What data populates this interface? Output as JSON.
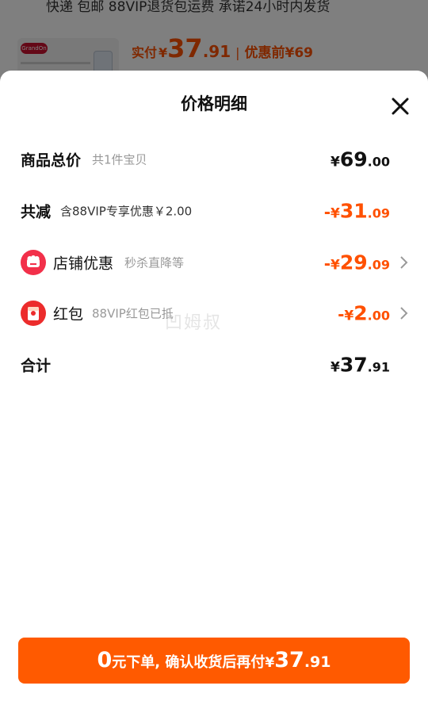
{
  "background": {
    "shipping_text": "快递 包邮 88VIP退货包运费 承诺24小时内发货",
    "logo_text": "GrandOn",
    "paid_label": "实付",
    "currency": "¥",
    "paid_int": "37",
    "paid_dec": ".91",
    "separator": "|",
    "orig_label": "优惠前",
    "orig_price": "¥69"
  },
  "sheet": {
    "title": "价格明细",
    "watermark": "凹姆叔"
  },
  "rows": {
    "total_goods": {
      "label": "商品总价",
      "sub": "共1件宝贝",
      "cur": "¥",
      "int": "69",
      "dec": ".00"
    },
    "reduction": {
      "label": "共减",
      "sub": "含88VIP专享优惠￥2.00",
      "minus": "-",
      "cur": "¥",
      "int": "31",
      "dec": ".09"
    },
    "shop_discount": {
      "label": "店铺优惠",
      "sub": "秒杀直降等",
      "minus": "-",
      "cur": "¥",
      "int": "29",
      "dec": ".09",
      "icon": "shop-icon"
    },
    "red_packet": {
      "label": "红包",
      "sub": "88VIP红包已抵",
      "minus": "-",
      "cur": "¥",
      "int": "2",
      "dec": ".00",
      "icon": "red-packet-icon"
    },
    "total": {
      "label": "合计",
      "cur": "¥",
      "int": "37",
      "dec": ".91"
    }
  },
  "button": {
    "zero": "0",
    "text": "元下单, 确认收货后再付",
    "cur": "¥",
    "int": "37",
    "dec": ".91"
  },
  "colors": {
    "accent": "#ff5000",
    "button": "#ff5a00",
    "text": "#111111",
    "muted": "#999999"
  }
}
